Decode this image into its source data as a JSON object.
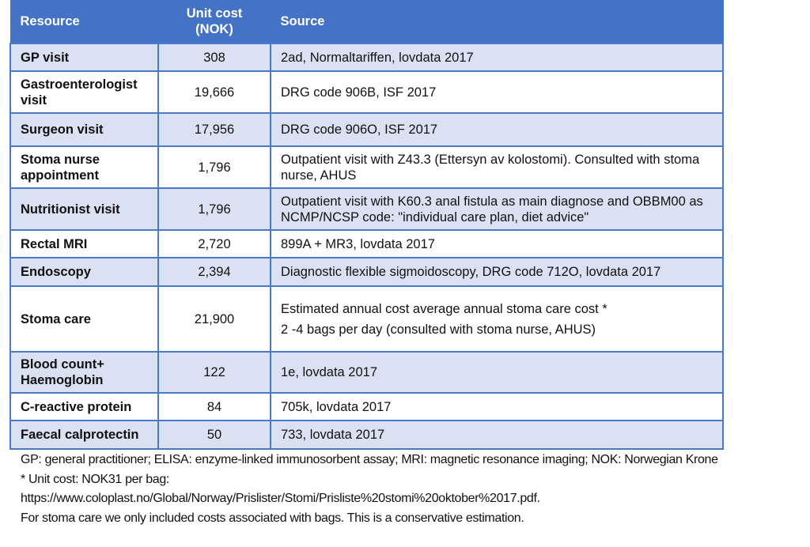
{
  "table": {
    "headers": {
      "resource": "Resource",
      "unit_cost_line1": "Unit cost",
      "unit_cost_line2": "(NOK)",
      "source": "Source"
    },
    "rows": [
      {
        "resource": "GP visit",
        "cost": "308",
        "source": [
          "2ad, Normaltariffen, lovdata 2017"
        ]
      },
      {
        "resource": "Gastroenterologist visit",
        "cost": "19,666",
        "source": [
          "DRG code 906B, ISF 2017"
        ]
      },
      {
        "resource": "Surgeon visit",
        "cost": "17,956",
        "source": [
          "DRG code 906O, ISF 2017"
        ]
      },
      {
        "resource": "Stoma nurse appointment",
        "cost": "1,796",
        "source": [
          "Outpatient visit with Z43.3 (Ettersyn av kolostomi). Consulted with stoma nurse, AHUS"
        ]
      },
      {
        "resource": "Nutritionist visit",
        "cost": "1,796",
        "source": [
          "Outpatient visit with K60.3 anal fistula as main diagnose and OBBM00 as NCMP/NCSP code: \"individual care plan, diet advice\""
        ]
      },
      {
        "resource": "Rectal MRI",
        "cost": "2,720",
        "source": [
          "899A + MR3, lovdata 2017"
        ]
      },
      {
        "resource": "Endoscopy",
        "cost": "2,394",
        "source": [
          "Diagnostic flexible sigmoidoscopy, DRG code 712O, lovdata 2017"
        ]
      },
      {
        "resource": "Stoma care",
        "cost": "21,900",
        "source": [
          "Estimated annual cost average annual stoma care cost *",
          "2 -4 bags per day (consulted with stoma nurse, AHUS)"
        ]
      },
      {
        "resource": "Blood count+ Haemoglobin",
        "cost": "122",
        "source": [
          "1e, lovdata 2017"
        ]
      },
      {
        "resource": "C-reactive protein",
        "cost": "84",
        "source": [
          "705k, lovdata 2017"
        ]
      },
      {
        "resource": "Faecal calprotectin",
        "cost": "50",
        "source": [
          "733, lovdata 2017"
        ]
      }
    ]
  },
  "notes": {
    "abbreviations": "GP: general practitioner; ELISA: enzyme-linked immunosorbent assay; MRI: magnetic resonance imaging; NOK: Norwegian Krone",
    "unit_cost_note": "* Unit cost: NOK31 per bag:",
    "url": "https://www.coloplast.no/Global/Norway/Prislister/Stomi/Prisliste%20stomi%20oktober%2017.pdf.",
    "stoma_note": "For stoma care we only included costs associated with bags. This is a conservative estimation."
  },
  "colors": {
    "header_bg": "#4472c4",
    "alt_row_bg": "#dae1f2",
    "border": "#4a7ac6"
  }
}
